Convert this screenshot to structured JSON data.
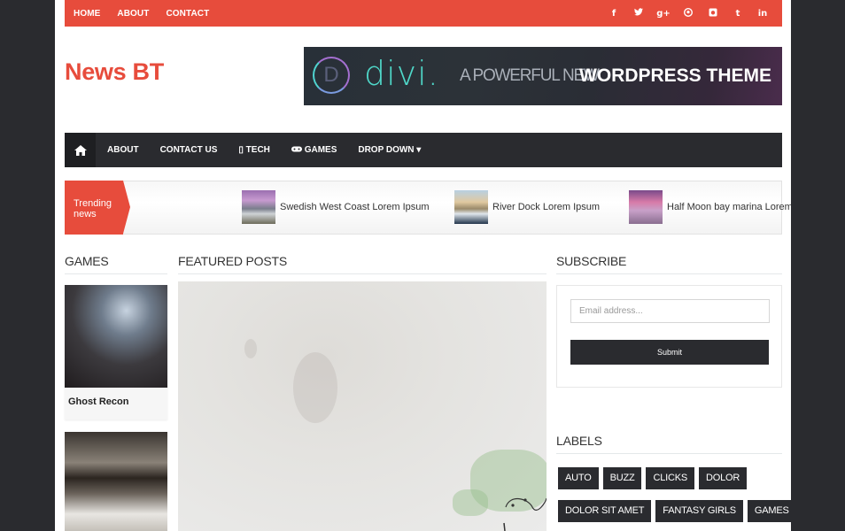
{
  "topbar": {
    "links": [
      "HOME",
      "ABOUT",
      "CONTACT"
    ],
    "social": [
      {
        "icon": "facebook-icon",
        "glyph": "f"
      },
      {
        "icon": "twitter-icon",
        "glyph": "🐦"
      },
      {
        "icon": "google-plus-icon",
        "glyph": "g+"
      },
      {
        "icon": "pinterest-icon",
        "glyph": "℗"
      },
      {
        "icon": "instagram-icon",
        "glyph": "◙"
      },
      {
        "icon": "tumblr-icon",
        "glyph": "t"
      },
      {
        "icon": "linkedin-icon",
        "glyph": "in"
      }
    ],
    "color": "#e74c3c"
  },
  "header": {
    "logo": "News BT",
    "banner": {
      "brand_letter": "D",
      "brand": "divi.",
      "tagline_light": "A POWERFUL NEW",
      "tagline_bold": "WORDPRESS THEME"
    }
  },
  "mainnav": {
    "home_icon": "⌂",
    "items": [
      {
        "label": "ABOUT",
        "icon": ""
      },
      {
        "label": "CONTACT US",
        "icon": ""
      },
      {
        "label": "TECH",
        "icon": "▯"
      },
      {
        "label": "GAMES",
        "icon": "🎮"
      },
      {
        "label": "DROP DOWN",
        "icon": "",
        "caret": "▾"
      }
    ]
  },
  "trending": {
    "label": "Trending news",
    "items": [
      {
        "title": "Swedish West Coast Lorem Ipsum"
      },
      {
        "title": "River Dock Lorem Ipsum"
      },
      {
        "title": "Half Moon bay marina Lorem Ipsum"
      }
    ]
  },
  "games": {
    "title": "GAMES",
    "posts": [
      {
        "title": "Ghost Recon"
      },
      {
        "title": ""
      }
    ]
  },
  "featured": {
    "title": "FEATURED POSTS"
  },
  "subscribe": {
    "title": "SUBSCRIBE",
    "placeholder": "Email address...",
    "button": "Submit"
  },
  "labels": {
    "title": "LABELS",
    "rows": [
      [
        "AUTO",
        "BUZZ",
        "CLICKS",
        "DOLOR"
      ],
      [
        "DOLOR SIT AMET",
        "FANTASY GIRLS",
        "GAMES"
      ]
    ]
  }
}
